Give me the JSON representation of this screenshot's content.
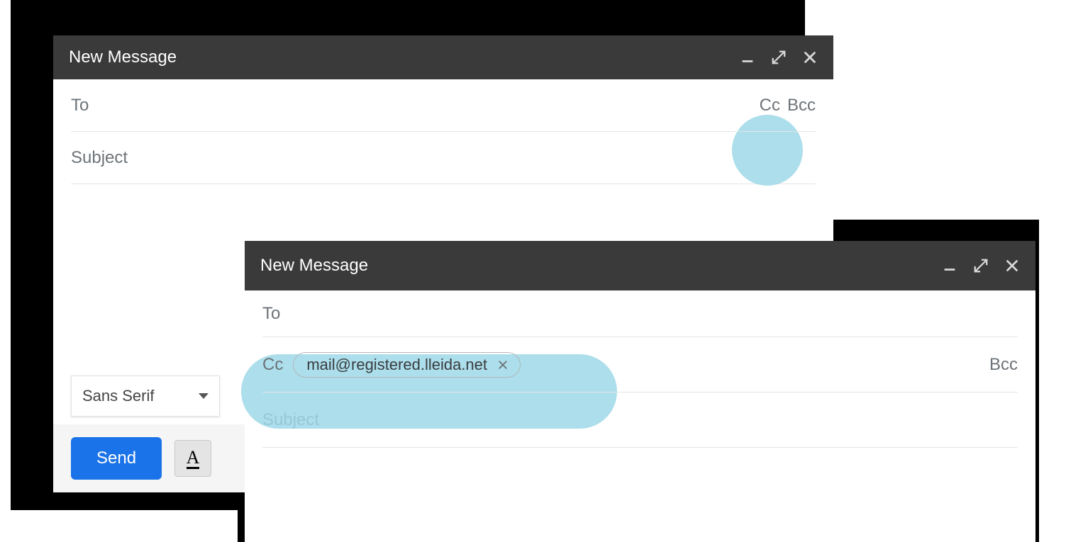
{
  "window1": {
    "title": "New Message",
    "to_label": "To",
    "cc_label": "Cc",
    "bcc_label": "Bcc",
    "subject_label": "Subject",
    "font_name": "Sans Serif",
    "send_label": "Send",
    "format_glyph": "A"
  },
  "window2": {
    "title": "New Message",
    "to_label": "To",
    "cc_label": "Cc",
    "cc_chip_email": "mail@registered.lleida.net",
    "bcc_label": "Bcc",
    "subject_label": "Subject"
  }
}
